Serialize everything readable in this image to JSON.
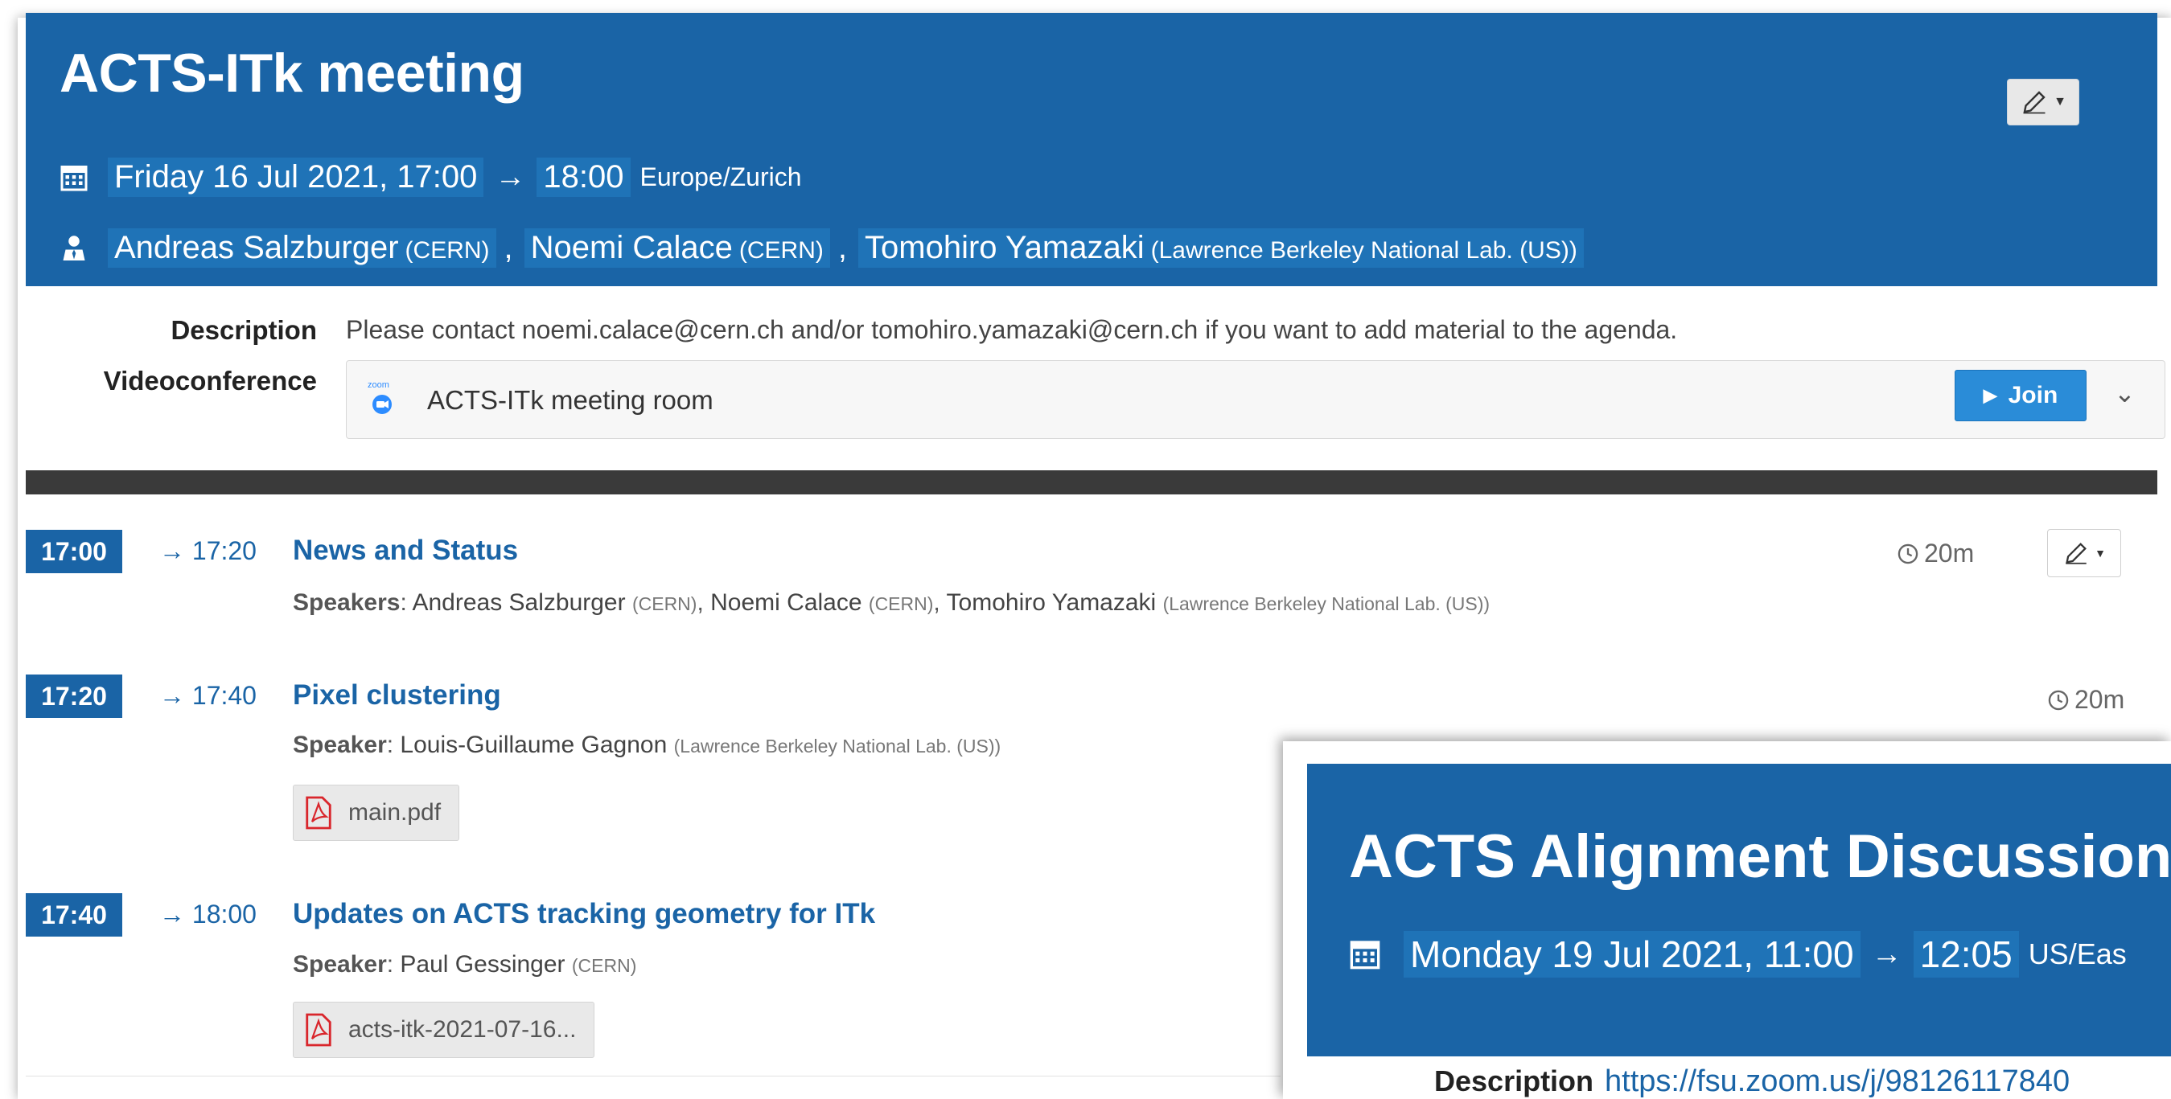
{
  "event": {
    "title": "ACTS-ITk meeting",
    "date_start": "Friday 16 Jul 2021, 17:00",
    "date_end": "18:00",
    "timezone": "Europe/Zurich",
    "chairs": [
      {
        "name": "Andreas Salzburger",
        "affiliation": "(CERN)"
      },
      {
        "name": "Noemi Calace",
        "affiliation": "(CERN)"
      },
      {
        "name": "Tomohiro Yamazaki",
        "affiliation": "(Lawrence Berkeley National Lab. (US))"
      }
    ],
    "separator": ","
  },
  "labels": {
    "description": "Description",
    "videoconference": "Videoconference",
    "speakers": "Speakers",
    "speaker": "Speaker"
  },
  "description": "Please contact noemi.calace@cern.ch and/or tomohiro.yamazaki@cern.ch if you want to add material to the agenda.",
  "videoconference": {
    "room": "ACTS-ITk meeting room",
    "join_label": "Join",
    "icon": "zoom-icon"
  },
  "contributions": [
    {
      "start": "17:00",
      "end": "→ 17:20",
      "title": "News and Status",
      "speaker_label": "Speakers",
      "speakers": [
        {
          "name": "Andreas Salzburger",
          "affiliation": "(CERN)"
        },
        {
          "name": "Noemi Calace",
          "affiliation": "(CERN)"
        },
        {
          "name": "Tomohiro Yamazaki",
          "affiliation": "(Lawrence Berkeley National Lab. (US))"
        }
      ],
      "duration": "20m"
    },
    {
      "start": "17:20",
      "end": "→ 17:40",
      "title": "Pixel clustering",
      "speaker_label": "Speaker",
      "speakers": [
        {
          "name": "Louis-Guillaume Gagnon",
          "affiliation": "(Lawrence Berkeley National Lab. (US))"
        }
      ],
      "duration": "20m",
      "attachment": "main.pdf"
    },
    {
      "start": "17:40",
      "end": "→ 18:00",
      "title": "Updates on ACTS tracking geometry for ITk",
      "speaker_label": "Speaker",
      "speakers": [
        {
          "name": "Paul Gessinger",
          "affiliation": "(CERN)"
        }
      ],
      "attachment": "acts-itk-2021-07-16..."
    }
  ],
  "overlay": {
    "title": "ACTS Alignment Discussion",
    "date_start": "Monday 19 Jul 2021, 11:00",
    "date_end": "12:05",
    "timezone": "US/Eas",
    "description_label": "Description",
    "description": "https://fsu.zoom.us/j/98126117840"
  },
  "colors": {
    "header_blue": "#1a64a6",
    "join_blue": "#2a8cd8",
    "dark_bar": "#3a3a3a",
    "pdf_red": "#d9262c"
  }
}
